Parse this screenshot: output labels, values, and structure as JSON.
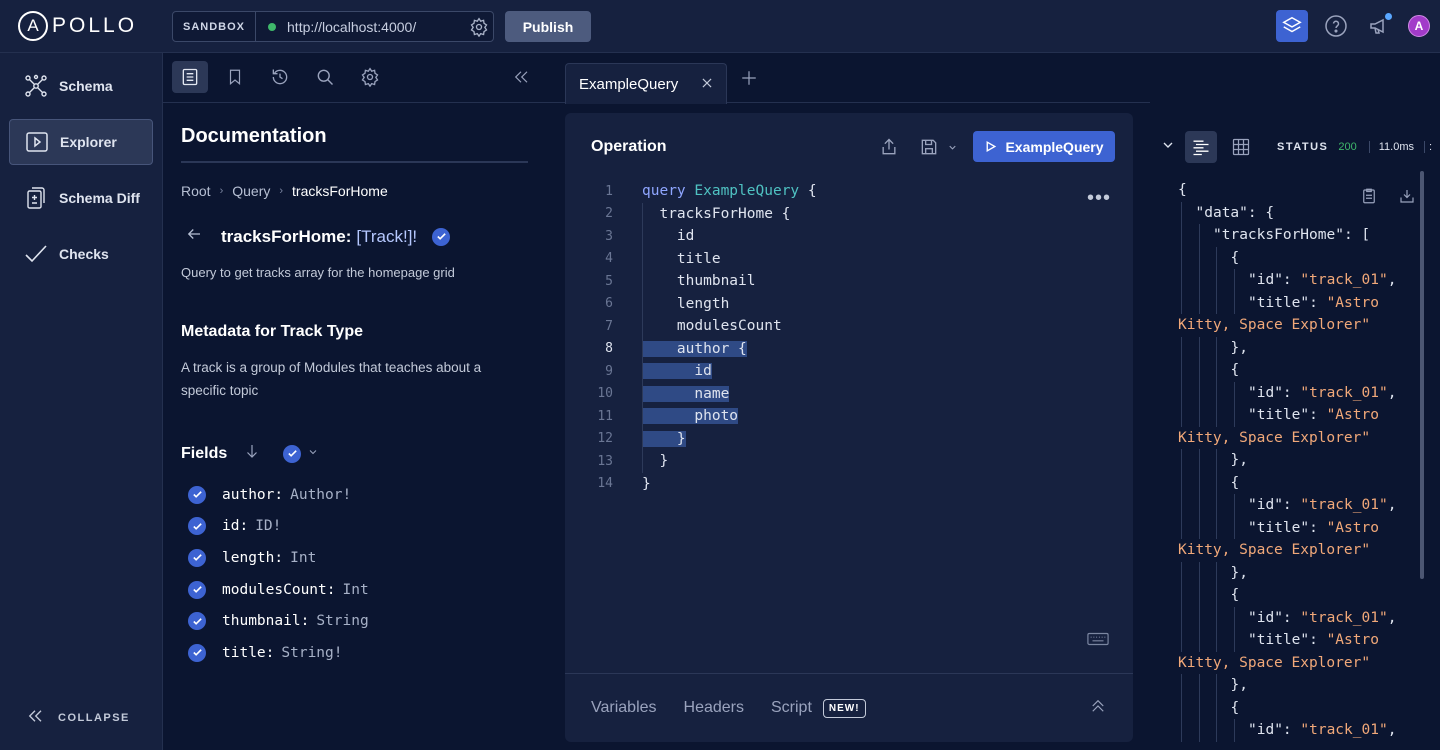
{
  "app": {
    "logo_text": "POLLO",
    "logo_ring_letter": "A",
    "sandbox_label": "SANDBOX",
    "endpoint_url": "http://localhost:4000/",
    "publish_label": "Publish",
    "avatar_initial": "A"
  },
  "nav": {
    "items": [
      {
        "label": "Schema",
        "icon": "schema-graph-icon"
      },
      {
        "label": "Explorer",
        "icon": "play-square-icon",
        "active": true
      },
      {
        "label": "Schema Diff",
        "icon": "diff-doc-icon"
      },
      {
        "label": "Checks",
        "icon": "check-icon"
      }
    ],
    "collapse_label": "COLLAPSE"
  },
  "docs": {
    "title": "Documentation",
    "breadcrumb": [
      "Root",
      "Query",
      "tracksForHome"
    ],
    "field_name": "tracksForHome:",
    "field_type": "[Track!]!",
    "field_description": "Query to get tracks array for the homepage grid",
    "metadata_title": "Metadata for Track Type",
    "metadata_description": "A track is a group of Modules that teaches about a specific topic",
    "fields_label": "Fields",
    "fields": [
      {
        "name": "author:",
        "type": "Author!"
      },
      {
        "name": "id:",
        "type": "ID!"
      },
      {
        "name": "length:",
        "type": "Int"
      },
      {
        "name": "modulesCount:",
        "type": "Int"
      },
      {
        "name": "thumbnail:",
        "type": "String"
      },
      {
        "name": "title:",
        "type": "String!"
      }
    ]
  },
  "tabs": [
    {
      "label": "ExampleQuery",
      "active": true
    }
  ],
  "operation": {
    "title": "Operation",
    "run_label": "ExampleQuery",
    "code": [
      {
        "n": "1",
        "kw": "query",
        "name": "ExampleQuery",
        "rest": " {"
      },
      {
        "n": "2",
        "text": "  tracksForHome {"
      },
      {
        "n": "3",
        "text": "    id"
      },
      {
        "n": "4",
        "text": "    title"
      },
      {
        "n": "5",
        "text": "    thumbnail"
      },
      {
        "n": "6",
        "text": "    length"
      },
      {
        "n": "7",
        "text": "    modulesCount"
      },
      {
        "n": "8",
        "text": "    author {",
        "selected": true,
        "current": true
      },
      {
        "n": "9",
        "text": "      id",
        "selected": true
      },
      {
        "n": "10",
        "text": "      name",
        "selected": true
      },
      {
        "n": "11",
        "text": "      photo",
        "selected": true
      },
      {
        "n": "12",
        "text": "    }",
        "selected": true
      },
      {
        "n": "13",
        "text": "  }"
      },
      {
        "n": "14",
        "text": "}"
      }
    ],
    "footer_tabs": [
      "Variables",
      "Headers",
      "Script"
    ],
    "new_badge": "NEW!"
  },
  "response": {
    "status_label": "STATUS",
    "status_code": "200",
    "duration": "11.0ms",
    "json_lines": [
      {
        "t": "{",
        "ind": 0
      },
      {
        "k": "\"data\"",
        "t": ": {",
        "ind": 1
      },
      {
        "k": "\"tracksForHome\"",
        "t": ": [",
        "ind": 2
      },
      {
        "t": "{",
        "ind": 3
      },
      {
        "k": "\"id\"",
        "t": ": ",
        "s": "\"track_01\"",
        "tail": ",",
        "ind": 4
      },
      {
        "k": "\"title\"",
        "t": ": ",
        "s": "\"Astro",
        "ind": 4
      },
      {
        "s": "Kitty, Space Explorer\"",
        "ind": 0
      },
      {
        "t": "},",
        "ind": 3
      },
      {
        "t": "{",
        "ind": 3
      },
      {
        "k": "\"id\"",
        "t": ": ",
        "s": "\"track_01\"",
        "tail": ",",
        "ind": 4
      },
      {
        "k": "\"title\"",
        "t": ": ",
        "s": "\"Astro",
        "ind": 4
      },
      {
        "s": "Kitty, Space Explorer\"",
        "ind": 0
      },
      {
        "t": "},",
        "ind": 3
      },
      {
        "t": "{",
        "ind": 3
      },
      {
        "k": "\"id\"",
        "t": ": ",
        "s": "\"track_01\"",
        "tail": ",",
        "ind": 4
      },
      {
        "k": "\"title\"",
        "t": ": ",
        "s": "\"Astro",
        "ind": 4
      },
      {
        "s": "Kitty, Space Explorer\"",
        "ind": 0
      },
      {
        "t": "},",
        "ind": 3
      },
      {
        "t": "{",
        "ind": 3
      },
      {
        "k": "\"id\"",
        "t": ": ",
        "s": "\"track_01\"",
        "tail": ",",
        "ind": 4
      },
      {
        "k": "\"title\"",
        "t": ": ",
        "s": "\"Astro",
        "ind": 4
      },
      {
        "s": "Kitty, Space Explorer\"",
        "ind": 0
      },
      {
        "t": "},",
        "ind": 3
      },
      {
        "t": "{",
        "ind": 3
      },
      {
        "k": "\"id\"",
        "t": ": ",
        "s": "\"track_01\"",
        "tail": ",",
        "ind": 4
      }
    ]
  },
  "colors": {
    "accent": "#3d63d2",
    "background": "#0b1530",
    "panel": "#16213f",
    "status_ok": "#3fb86b",
    "json_string": "#f1a879"
  }
}
